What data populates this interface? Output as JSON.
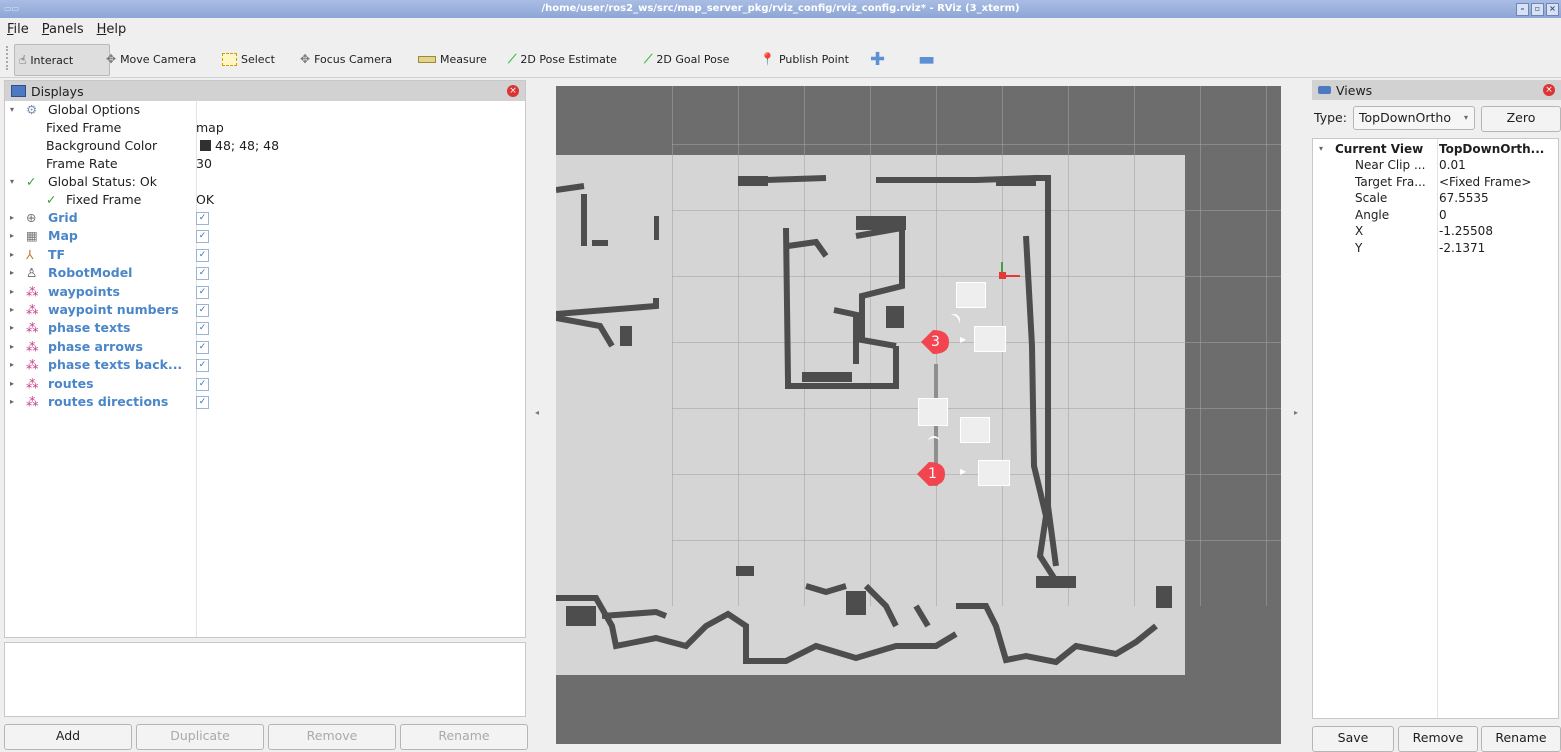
{
  "window": {
    "title": "/home/user/ros2_ws/src/map_server_pkg/rviz_config/rviz_config.rviz* - RViz (3_xterm)"
  },
  "menu": [
    "File",
    "Panels",
    "Help"
  ],
  "toolbar": {
    "tools": [
      {
        "label": "Interact",
        "icon": "hand-cursor-icon"
      },
      {
        "label": "Move Camera",
        "icon": "move-arrows-icon"
      },
      {
        "label": "Select",
        "icon": "select-box-icon"
      },
      {
        "label": "Focus Camera",
        "icon": "focus-target-icon"
      },
      {
        "label": "Measure",
        "icon": "ruler-icon"
      },
      {
        "label": "2D Pose Estimate",
        "icon": "green-arrow-icon"
      },
      {
        "label": "2D Goal Pose",
        "icon": "green-arrow-icon"
      },
      {
        "label": "Publish Point",
        "icon": "map-pin-icon"
      }
    ],
    "active": "Interact"
  },
  "displays": {
    "title": "Displays",
    "global_options": {
      "label": "Global Options",
      "fixed_frame_label": "Fixed Frame",
      "fixed_frame": "map",
      "bg_color_label": "Background Color",
      "bg_color": "48; 48; 48",
      "frame_rate_label": "Frame Rate",
      "frame_rate": "30"
    },
    "global_status": {
      "label": "Global Status: Ok",
      "fixed_frame_label": "Fixed Frame",
      "fixed_frame_status": "OK"
    },
    "items": [
      {
        "label": "Grid",
        "icon": "grid-icon"
      },
      {
        "label": "Map",
        "icon": "map-icon"
      },
      {
        "label": "TF",
        "icon": "tf-axes-icon"
      },
      {
        "label": "RobotModel",
        "icon": "robot-icon"
      },
      {
        "label": "waypoints",
        "icon": "marker-balls-icon"
      },
      {
        "label": "waypoint numbers",
        "icon": "marker-balls-icon"
      },
      {
        "label": "phase texts",
        "icon": "marker-balls-icon"
      },
      {
        "label": "phase arrows",
        "icon": "marker-balls-icon"
      },
      {
        "label": "phase texts back...",
        "icon": "marker-balls-icon"
      },
      {
        "label": "routes",
        "icon": "marker-balls-icon"
      },
      {
        "label": "routes directions",
        "icon": "marker-balls-icon"
      }
    ],
    "buttons": {
      "add": "Add",
      "duplicate": "Duplicate",
      "remove": "Remove",
      "rename": "Rename"
    }
  },
  "viewport": {
    "waypoints": [
      "3",
      "1"
    ]
  },
  "views": {
    "title": "Views",
    "type_label": "Type:",
    "type_value": "TopDownOrtho",
    "zero": "Zero",
    "current_view_label": "Current View",
    "current_view_value": "TopDownOrth...",
    "props": [
      {
        "k": "Near Clip ...",
        "v": "0.01"
      },
      {
        "k": "Target Fra...",
        "v": "<Fixed Frame>"
      },
      {
        "k": "Scale",
        "v": "67.5535"
      },
      {
        "k": "Angle",
        "v": "0"
      },
      {
        "k": "X",
        "v": "-1.25508"
      },
      {
        "k": "Y",
        "v": "-2.1371"
      }
    ],
    "buttons": {
      "save": "Save",
      "remove": "Remove",
      "rename": "Rename"
    }
  },
  "colors": {
    "accent_blue": "#4a86c8",
    "waypoint_red": "#f2454f",
    "map_wall": "#4d4d4d",
    "map_free": "#d5d5d5",
    "viewport_bg": "#6d6d6d"
  }
}
